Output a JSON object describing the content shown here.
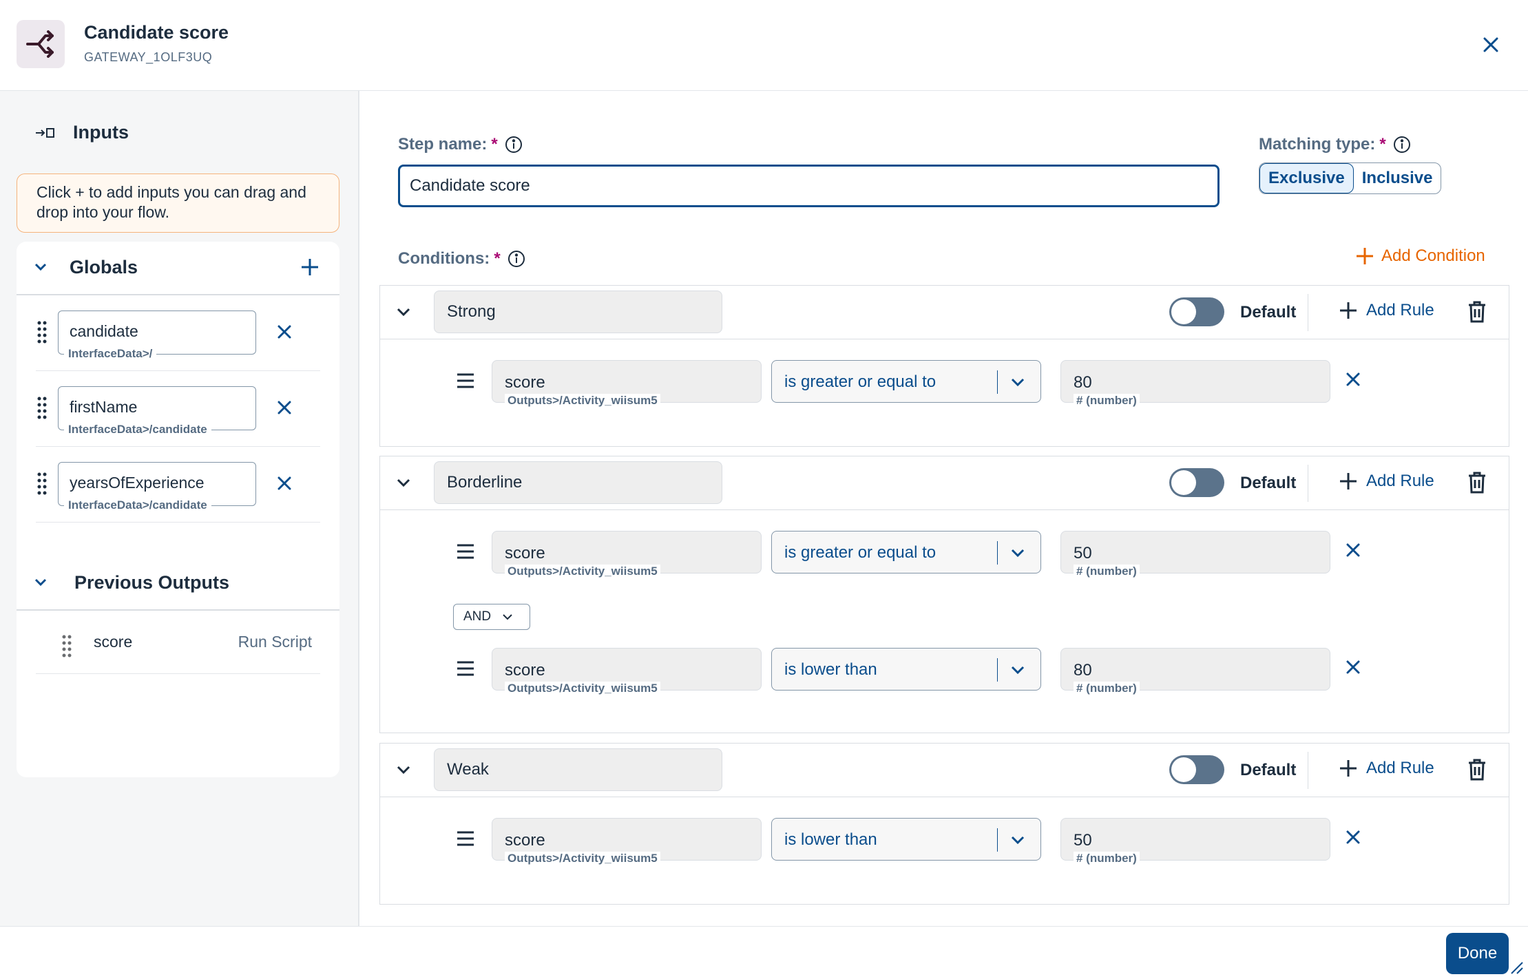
{
  "header": {
    "title": "Candidate score",
    "subtitle": "GATEWAY_1OLF3UQ"
  },
  "left": {
    "inputs_label": "Inputs",
    "hint": "Click + to add inputs you can drag and drop into your flow.",
    "globals_label": "Globals",
    "globals": [
      {
        "name": "candidate",
        "path": "InterfaceData>/"
      },
      {
        "name": "firstName",
        "path": "InterfaceData>/candidate"
      },
      {
        "name": "yearsOfExperience",
        "path": "InterfaceData>/candidate"
      }
    ],
    "previous_outputs_label": "Previous Outputs",
    "previous_outputs": [
      {
        "name": "score",
        "source": "Run Script"
      }
    ]
  },
  "form": {
    "step_name_label": "Step name:",
    "step_name_value": "Candidate score",
    "matching_type_label": "Matching type:",
    "matching_options": [
      "Exclusive",
      "Inclusive"
    ],
    "conditions_label": "Conditions:",
    "required_mark": "*",
    "add_condition": "Add Condition",
    "default_label": "Default",
    "add_rule": "Add Rule"
  },
  "conditions": [
    {
      "name": "Strong",
      "rules": [
        {
          "field": "score",
          "field_path": "Outputs>/Activity_wiisum5",
          "operator": "is greater or equal to",
          "value": "80",
          "value_type": "# (number)"
        }
      ]
    },
    {
      "name": "Borderline",
      "connector": "AND",
      "rules": [
        {
          "field": "score",
          "field_path": "Outputs>/Activity_wiisum5",
          "operator": "is greater or equal to",
          "value": "50",
          "value_type": "# (number)"
        },
        {
          "field": "score",
          "field_path": "Outputs>/Activity_wiisum5",
          "operator": "is lower than",
          "value": "80",
          "value_type": "# (number)"
        }
      ]
    },
    {
      "name": "Weak",
      "rules": [
        {
          "field": "score",
          "field_path": "Outputs>/Activity_wiisum5",
          "operator": "is lower than",
          "value": "50",
          "value_type": "# (number)"
        }
      ]
    }
  ],
  "footer": {
    "done": "Done"
  },
  "colors": {
    "primary": "#0a4d8c",
    "accent": "#e76500",
    "required": "#aa0a74"
  }
}
